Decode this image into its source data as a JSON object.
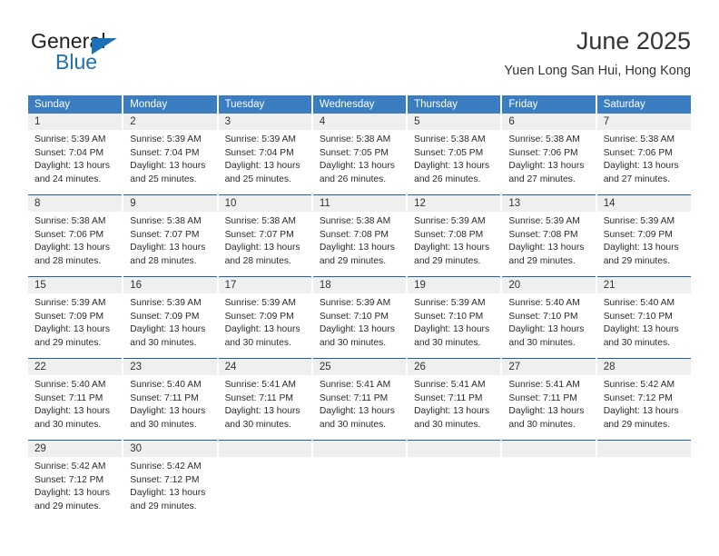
{
  "brand": {
    "name_top": "General",
    "name_bottom": "Blue",
    "accent_color": "#1b70b8"
  },
  "header": {
    "title": "June 2025",
    "subtitle": "Yuen Long San Hui, Hong Kong"
  },
  "theme": {
    "header_bg": "#3a7dc0",
    "header_text": "#ffffff",
    "daynum_bg": "#efefef",
    "cell_bg": "#ffffff",
    "row_divider": "#1f5fa8"
  },
  "calendar": {
    "weekday_headers": [
      "Sunday",
      "Monday",
      "Tuesday",
      "Wednesday",
      "Thursday",
      "Friday",
      "Saturday"
    ],
    "labels": {
      "sunrise": "Sunrise:",
      "sunset": "Sunset:",
      "daylight": "Daylight:"
    },
    "weeks": [
      [
        {
          "day": "1",
          "sunrise": "Sunrise: 5:39 AM",
          "sunset": "Sunset: 7:04 PM",
          "daylight": "Daylight: 13 hours and 24 minutes."
        },
        {
          "day": "2",
          "sunrise": "Sunrise: 5:39 AM",
          "sunset": "Sunset: 7:04 PM",
          "daylight": "Daylight: 13 hours and 25 minutes."
        },
        {
          "day": "3",
          "sunrise": "Sunrise: 5:39 AM",
          "sunset": "Sunset: 7:04 PM",
          "daylight": "Daylight: 13 hours and 25 minutes."
        },
        {
          "day": "4",
          "sunrise": "Sunrise: 5:38 AM",
          "sunset": "Sunset: 7:05 PM",
          "daylight": "Daylight: 13 hours and 26 minutes."
        },
        {
          "day": "5",
          "sunrise": "Sunrise: 5:38 AM",
          "sunset": "Sunset: 7:05 PM",
          "daylight": "Daylight: 13 hours and 26 minutes."
        },
        {
          "day": "6",
          "sunrise": "Sunrise: 5:38 AM",
          "sunset": "Sunset: 7:06 PM",
          "daylight": "Daylight: 13 hours and 27 minutes."
        },
        {
          "day": "7",
          "sunrise": "Sunrise: 5:38 AM",
          "sunset": "Sunset: 7:06 PM",
          "daylight": "Daylight: 13 hours and 27 minutes."
        }
      ],
      [
        {
          "day": "8",
          "sunrise": "Sunrise: 5:38 AM",
          "sunset": "Sunset: 7:06 PM",
          "daylight": "Daylight: 13 hours and 28 minutes."
        },
        {
          "day": "9",
          "sunrise": "Sunrise: 5:38 AM",
          "sunset": "Sunset: 7:07 PM",
          "daylight": "Daylight: 13 hours and 28 minutes."
        },
        {
          "day": "10",
          "sunrise": "Sunrise: 5:38 AM",
          "sunset": "Sunset: 7:07 PM",
          "daylight": "Daylight: 13 hours and 28 minutes."
        },
        {
          "day": "11",
          "sunrise": "Sunrise: 5:38 AM",
          "sunset": "Sunset: 7:08 PM",
          "daylight": "Daylight: 13 hours and 29 minutes."
        },
        {
          "day": "12",
          "sunrise": "Sunrise: 5:39 AM",
          "sunset": "Sunset: 7:08 PM",
          "daylight": "Daylight: 13 hours and 29 minutes."
        },
        {
          "day": "13",
          "sunrise": "Sunrise: 5:39 AM",
          "sunset": "Sunset: 7:08 PM",
          "daylight": "Daylight: 13 hours and 29 minutes."
        },
        {
          "day": "14",
          "sunrise": "Sunrise: 5:39 AM",
          "sunset": "Sunset: 7:09 PM",
          "daylight": "Daylight: 13 hours and 29 minutes."
        }
      ],
      [
        {
          "day": "15",
          "sunrise": "Sunrise: 5:39 AM",
          "sunset": "Sunset: 7:09 PM",
          "daylight": "Daylight: 13 hours and 29 minutes."
        },
        {
          "day": "16",
          "sunrise": "Sunrise: 5:39 AM",
          "sunset": "Sunset: 7:09 PM",
          "daylight": "Daylight: 13 hours and 30 minutes."
        },
        {
          "day": "17",
          "sunrise": "Sunrise: 5:39 AM",
          "sunset": "Sunset: 7:09 PM",
          "daylight": "Daylight: 13 hours and 30 minutes."
        },
        {
          "day": "18",
          "sunrise": "Sunrise: 5:39 AM",
          "sunset": "Sunset: 7:10 PM",
          "daylight": "Daylight: 13 hours and 30 minutes."
        },
        {
          "day": "19",
          "sunrise": "Sunrise: 5:39 AM",
          "sunset": "Sunset: 7:10 PM",
          "daylight": "Daylight: 13 hours and 30 minutes."
        },
        {
          "day": "20",
          "sunrise": "Sunrise: 5:40 AM",
          "sunset": "Sunset: 7:10 PM",
          "daylight": "Daylight: 13 hours and 30 minutes."
        },
        {
          "day": "21",
          "sunrise": "Sunrise: 5:40 AM",
          "sunset": "Sunset: 7:10 PM",
          "daylight": "Daylight: 13 hours and 30 minutes."
        }
      ],
      [
        {
          "day": "22",
          "sunrise": "Sunrise: 5:40 AM",
          "sunset": "Sunset: 7:11 PM",
          "daylight": "Daylight: 13 hours and 30 minutes."
        },
        {
          "day": "23",
          "sunrise": "Sunrise: 5:40 AM",
          "sunset": "Sunset: 7:11 PM",
          "daylight": "Daylight: 13 hours and 30 minutes."
        },
        {
          "day": "24",
          "sunrise": "Sunrise: 5:41 AM",
          "sunset": "Sunset: 7:11 PM",
          "daylight": "Daylight: 13 hours and 30 minutes."
        },
        {
          "day": "25",
          "sunrise": "Sunrise: 5:41 AM",
          "sunset": "Sunset: 7:11 PM",
          "daylight": "Daylight: 13 hours and 30 minutes."
        },
        {
          "day": "26",
          "sunrise": "Sunrise: 5:41 AM",
          "sunset": "Sunset: 7:11 PM",
          "daylight": "Daylight: 13 hours and 30 minutes."
        },
        {
          "day": "27",
          "sunrise": "Sunrise: 5:41 AM",
          "sunset": "Sunset: 7:11 PM",
          "daylight": "Daylight: 13 hours and 30 minutes."
        },
        {
          "day": "28",
          "sunrise": "Sunrise: 5:42 AM",
          "sunset": "Sunset: 7:12 PM",
          "daylight": "Daylight: 13 hours and 29 minutes."
        }
      ],
      [
        {
          "day": "29",
          "sunrise": "Sunrise: 5:42 AM",
          "sunset": "Sunset: 7:12 PM",
          "daylight": "Daylight: 13 hours and 29 minutes."
        },
        {
          "day": "30",
          "sunrise": "Sunrise: 5:42 AM",
          "sunset": "Sunset: 7:12 PM",
          "daylight": "Daylight: 13 hours and 29 minutes."
        },
        {
          "day": "",
          "sunrise": "",
          "sunset": "",
          "daylight": ""
        },
        {
          "day": "",
          "sunrise": "",
          "sunset": "",
          "daylight": ""
        },
        {
          "day": "",
          "sunrise": "",
          "sunset": "",
          "daylight": ""
        },
        {
          "day": "",
          "sunrise": "",
          "sunset": "",
          "daylight": ""
        },
        {
          "day": "",
          "sunrise": "",
          "sunset": "",
          "daylight": ""
        }
      ]
    ]
  }
}
